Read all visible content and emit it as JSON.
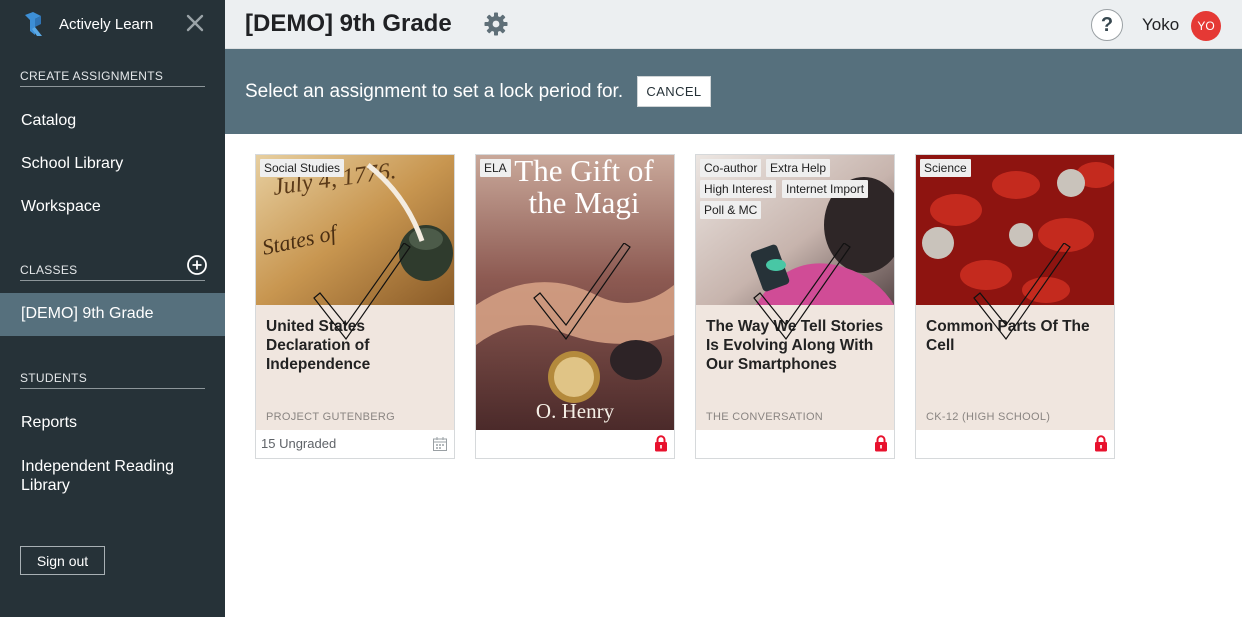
{
  "app": {
    "brand_name": "Actively Learn"
  },
  "sidebar": {
    "sections": {
      "create_assignments": "CREATE ASSIGNMENTS",
      "classes": "CLASSES",
      "students": "STUDENTS"
    },
    "create_items": [
      "Catalog",
      "School Library",
      "Workspace"
    ],
    "active_class": "[DEMO] 9th Grade",
    "student_items": [
      "Reports",
      "Independent Reading Library"
    ],
    "sign_out": "Sign out"
  },
  "header": {
    "title": "[DEMO] 9th Grade",
    "user_name": "Yoko",
    "user_initials": "YO",
    "help_glyph": "?"
  },
  "banner": {
    "message": "Select an assignment to set a lock period for.",
    "cancel_label": "CANCEL"
  },
  "cards": [
    {
      "tags": [
        "Social Studies"
      ],
      "title": "United States Declaration of Independence",
      "source": "PROJECT GUTENBERG",
      "footer_text": "15 Ungraded",
      "footer_icon": "calendar-icon"
    },
    {
      "tags": [
        "ELA"
      ],
      "cover_title": "The Gift of the Magi",
      "cover_author": "O. Henry",
      "footer_icon": "lock-icon"
    },
    {
      "tags": [
        "Co-author",
        "Extra Help",
        "High Interest",
        "Internet Import",
        "Poll & MC"
      ],
      "title": "The Way We Tell Stories Is Evolving Along With Our Smartphones",
      "source": "THE CONVERSATION",
      "footer_icon": "lock-icon"
    },
    {
      "tags": [
        "Science"
      ],
      "title": "Common Parts Of The Cell",
      "source": "CK-12 (HIGH SCHOOL)",
      "footer_icon": "lock-icon"
    }
  ],
  "colors": {
    "sidebar_bg": "#263238",
    "active_item_bg": "#56707d",
    "banner_bg": "#56707d",
    "topbar_bg": "#eceff1",
    "card_info_bg": "#f0e6df",
    "lock_red": "#e8112d",
    "avatar_red": "#e53935"
  }
}
